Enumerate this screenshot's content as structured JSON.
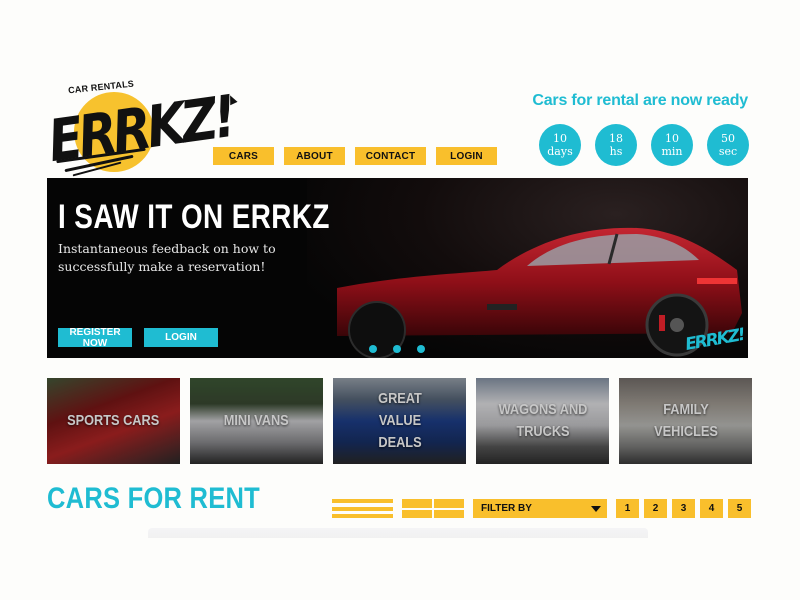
{
  "brand": {
    "tagline": "CAR RENTALS",
    "name": "ERRKZ!",
    "accent_yellow": "#f9bf2c",
    "accent_cyan": "#1fbcd2"
  },
  "nav": {
    "items": [
      {
        "label": "CARS"
      },
      {
        "label": "ABOUT"
      },
      {
        "label": "CONTACT"
      },
      {
        "label": "LOGIN"
      }
    ]
  },
  "countdown": {
    "heading": "Cars for rental are now ready",
    "units": [
      {
        "value": "10",
        "unit": "days"
      },
      {
        "value": "18",
        "unit": "hs"
      },
      {
        "value": "10",
        "unit": "min"
      },
      {
        "value": "50",
        "unit": "sec"
      }
    ]
  },
  "hero": {
    "title": "I SAW IT ON ERRKZ",
    "subtitle": "Instantaneous feedback on how to successfully make a reservation!",
    "register_label": "REGISTER NOW",
    "login_label": "LOGIN",
    "watermark": "ERRKZ!",
    "slides": 3
  },
  "categories": [
    {
      "label": "SPORTS CARS"
    },
    {
      "label": "MINI VANS"
    },
    {
      "label": "GREAT VALUE DEALS"
    },
    {
      "label": "WAGONS AND TRUCKS"
    },
    {
      "label": "FAMILY VEHICLES"
    }
  ],
  "listing": {
    "title": "CARS FOR RENT",
    "filter_label": "FILTER BY",
    "pages": [
      "1",
      "2",
      "3",
      "4",
      "5"
    ]
  }
}
